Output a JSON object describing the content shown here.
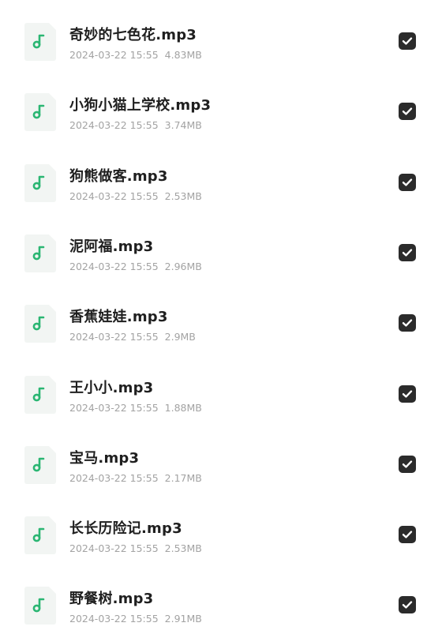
{
  "accent_color": "#2bb673",
  "checkbox_color": "#2b2b2b",
  "files": [
    {
      "name": "奇妙的七色花.mp3",
      "date": "2024-03-22 15:55",
      "size": "4.83MB",
      "checked": true,
      "icon": "music-note-icon"
    },
    {
      "name": "小狗小猫上学校.mp3",
      "date": "2024-03-22 15:55",
      "size": "3.74MB",
      "checked": true,
      "icon": "music-note-icon"
    },
    {
      "name": "狗熊做客.mp3",
      "date": "2024-03-22 15:55",
      "size": "2.53MB",
      "checked": true,
      "icon": "music-note-icon"
    },
    {
      "name": "泥阿福.mp3",
      "date": "2024-03-22 15:55",
      "size": "2.96MB",
      "checked": true,
      "icon": "music-note-icon"
    },
    {
      "name": "香蕉娃娃.mp3",
      "date": "2024-03-22 15:55",
      "size": "2.9MB",
      "checked": true,
      "icon": "music-note-icon"
    },
    {
      "name": "王小小.mp3",
      "date": "2024-03-22 15:55",
      "size": "1.88MB",
      "checked": true,
      "icon": "music-note-icon"
    },
    {
      "name": "宝马.mp3",
      "date": "2024-03-22 15:55",
      "size": "2.17MB",
      "checked": true,
      "icon": "music-note-icon"
    },
    {
      "name": "长长历险记.mp3",
      "date": "2024-03-22 15:55",
      "size": "2.53MB",
      "checked": true,
      "icon": "music-note-icon"
    },
    {
      "name": "野餐树.mp3",
      "date": "2024-03-22 15:55",
      "size": "2.91MB",
      "checked": true,
      "icon": "music-note-icon"
    }
  ]
}
